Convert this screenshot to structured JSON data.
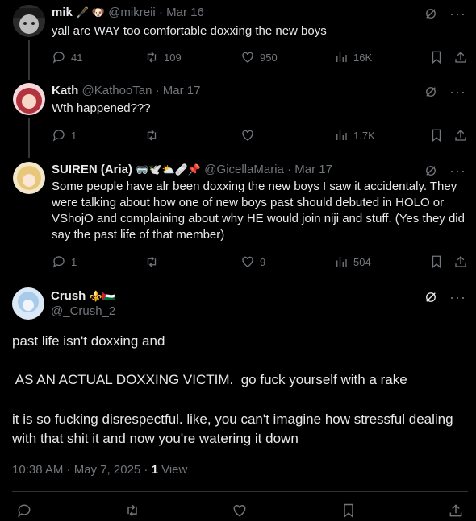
{
  "tweets": [
    {
      "name": "mik",
      "name_emoji": "🖋️ 🐶",
      "handle": "@mikreii",
      "date": "· Mar 16",
      "text": "yall are WAY too comfortable doxxing the new boys",
      "replies": "41",
      "retweets": "109",
      "likes": "950",
      "views": "16K"
    },
    {
      "name": "Kath",
      "name_emoji": "",
      "handle": "@KathooTan",
      "date": "· Mar 17",
      "text": "Wth happened???",
      "replies": "1",
      "retweets": "",
      "likes": "",
      "views": "1.7K"
    },
    {
      "name": "SUIREN (Aria)",
      "name_emoji": "🥽🕊️⛅🩹📌",
      "handle": "@GicellaMaria",
      "date": "· Mar 17",
      "text": "Some people have alr been doxxing the new boys I saw it accidentaly. They were talking about how one of new boys past should debuted in HOLO or VShojO and complaining about why HE would join niji and stuff. (Yes they did say the past life of that member)",
      "replies": "1",
      "retweets": "",
      "likes": "9",
      "views": "504"
    }
  ],
  "main_tweet": {
    "name": "Crush",
    "name_emoji": "⚜️🇵🇸",
    "handle": "@_Crush_2",
    "para1": "past life isn't doxxing and",
    "para2": " AS AN ACTUAL DOXXING VICTIM.  go fuck yourself with a rake",
    "para3": "it is so fucking disrespectful. like, you can't imagine how stressful dealing with that shit it and now you're watering it down",
    "time": "10:38 AM · May 7, 2025 ·",
    "view_count": "1",
    "view_label": "View"
  },
  "icons": {
    "reply": "reply-icon",
    "retweet": "retweet-icon",
    "like": "heart-icon",
    "views": "views-icon",
    "bookmark": "bookmark-icon",
    "share": "share-icon",
    "grok": "grok-icon",
    "more": "more-icon"
  },
  "colors": {
    "background": "#000000",
    "text": "#e7e9ea",
    "muted": "#71767b",
    "divider": "#2f3336"
  }
}
